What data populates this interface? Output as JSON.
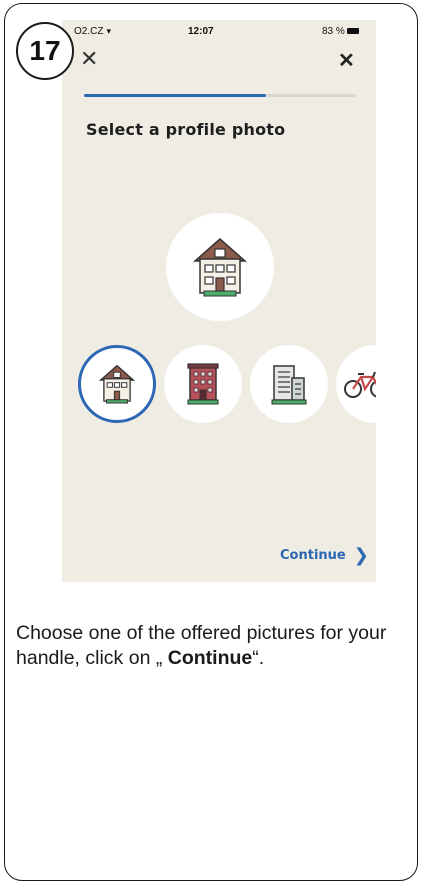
{
  "step": {
    "number": "17"
  },
  "status_bar": {
    "carrier": "O2.CZ",
    "time": "12:07",
    "battery": "83 %"
  },
  "nav": {
    "back_icon": "close-icon",
    "close_icon": "close-icon"
  },
  "progress": {
    "fraction": 0.67,
    "fill_color": "#2b67b3"
  },
  "screen": {
    "title": "Select a profile photo",
    "continue_label": "Continue"
  },
  "photo_options": [
    {
      "name": "house",
      "selected": true
    },
    {
      "name": "apartment-building",
      "selected": false
    },
    {
      "name": "office-building",
      "selected": false
    },
    {
      "name": "bicycle",
      "selected": false
    }
  ],
  "instruction": {
    "text_before": "Choose one of the offered pictures for your handle, click on „ ",
    "emphasis": "Continue",
    "text_after": "“."
  },
  "colors": {
    "accent": "#2b67b3",
    "screen_bg": "#eeece3"
  }
}
